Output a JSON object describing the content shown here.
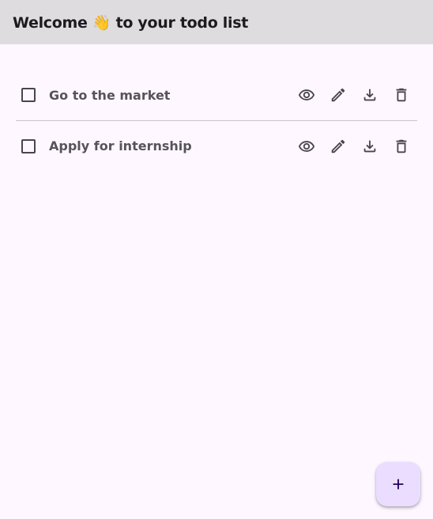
{
  "app_bar": {
    "title": "Welcome 👋 to your todo list"
  },
  "todos": [
    {
      "label": "Go to the market",
      "checked": false
    },
    {
      "label": "Apply for internship",
      "checked": false
    }
  ],
  "row_actions": [
    "eye-icon",
    "pencil-icon",
    "download-icon",
    "trash-icon"
  ],
  "fab": {
    "icon": "plus-icon"
  },
  "colors": {
    "app_bar_bg": "#dedcdf",
    "background": "#fef7ff",
    "fab_bg": "#eaddff",
    "icon": "#49454f"
  }
}
